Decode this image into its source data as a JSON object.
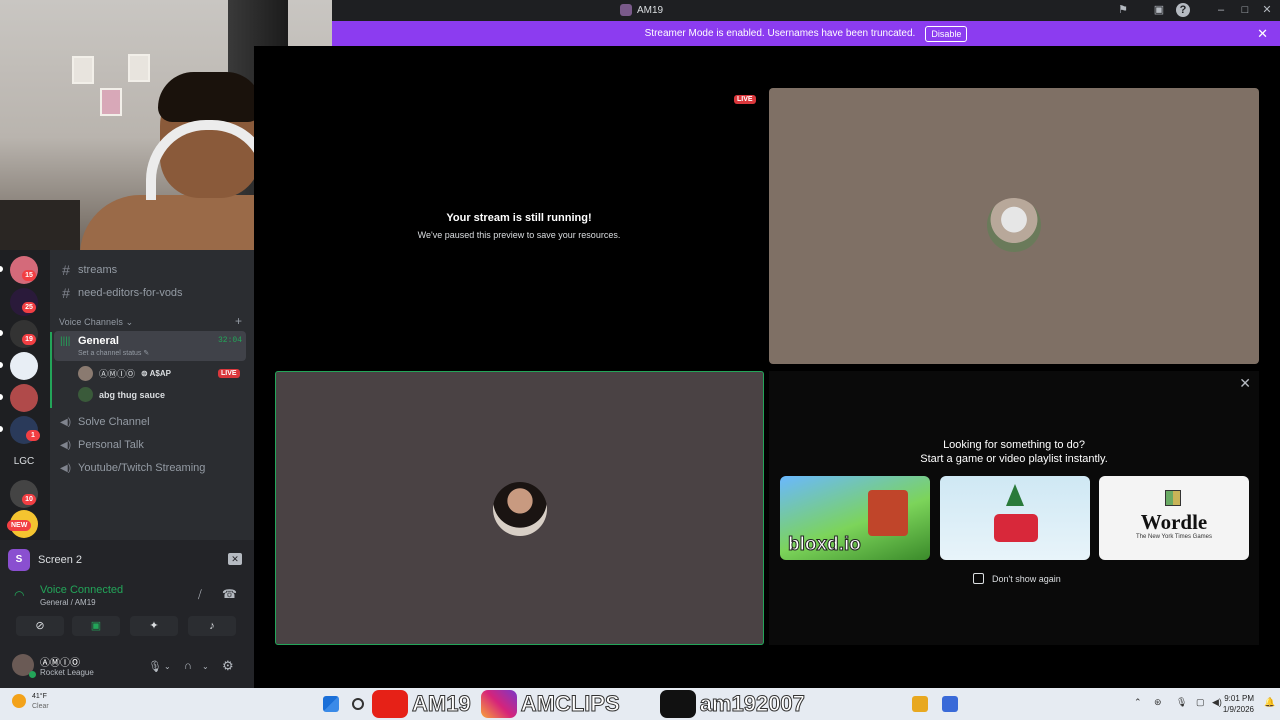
{
  "window": {
    "title": "AM19"
  },
  "banner": {
    "text": "Streamer Mode is enabled. Usernames have been truncated.",
    "button": "Disable"
  },
  "servers": [
    {
      "badge": "15"
    },
    {
      "badge": "25"
    },
    {
      "badge": "19"
    },
    {
      "badge": ""
    },
    {
      "badge": ""
    },
    {
      "badge": "1"
    },
    {
      "label": "LGC",
      "badge": ""
    },
    {
      "badge": "10"
    },
    {
      "badge": "NEW"
    }
  ],
  "channels": {
    "text": [
      "streams",
      "need-editors-for-vods"
    ],
    "voice_header": "Voice Channels",
    "general": {
      "name": "General",
      "status": "Set a channel status",
      "timer": "32:04"
    },
    "voice_users": [
      {
        "name": "ⒶⓂⒾⓄ",
        "tag": "A$AP",
        "live": "LIVE"
      },
      {
        "name": "abg thug sauce"
      }
    ],
    "voice_other": [
      "Solve Channel",
      "Personal Talk",
      "Youtube/Twitch Streaming"
    ]
  },
  "panel": {
    "screen": "Screen 2",
    "voice_status": "Voice Connected",
    "voice_location": "General / AM19",
    "user": {
      "name": "ⒶⓂⒾⓄ",
      "game": "Rocket League"
    }
  },
  "stage": {
    "paused_title": "Your stream is still running!",
    "paused_sub": "We've paused this preview to save your resources.",
    "live_tag": "LIVE"
  },
  "activity": {
    "line1": "Looking for something to do?",
    "line2": "Start a game or video playlist instantly.",
    "cards": [
      "bloxd.io",
      "",
      "Wordle"
    ],
    "wordle_sub": "The New York Times Games",
    "dont_show": "Don't show again"
  },
  "taskbar": {
    "temp": "41°F",
    "weather": "Clear",
    "time": "9:01 PM",
    "date": "1/9/2026",
    "overlay": [
      "AM19",
      "AMCLIPS",
      "am192007"
    ]
  },
  "colors": {
    "accent": "#8c3cf0",
    "green": "#23a559",
    "red": "#da373c"
  }
}
